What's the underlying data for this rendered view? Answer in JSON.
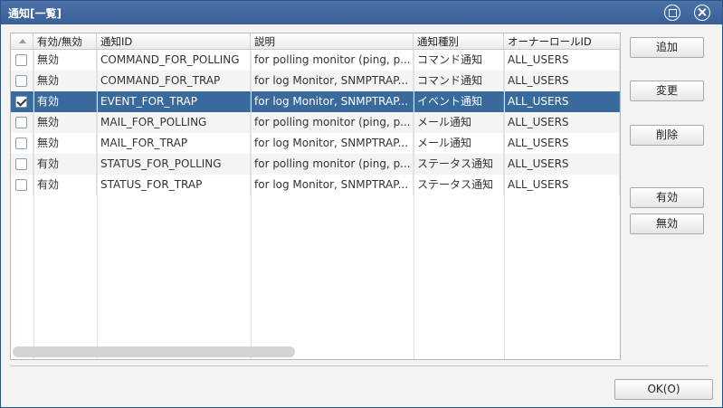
{
  "window": {
    "title": "通知[一覧]"
  },
  "grid": {
    "columns": [
      "有効/無効",
      "通知ID",
      "説明",
      "通知種別",
      "オーナーロールID"
    ],
    "rows": [
      {
        "checked": false,
        "enabled": "無効",
        "id": "COMMAND_FOR_POLLING",
        "desc": "for polling monitor (ping, p...",
        "type": "コマンド通知",
        "owner": "ALL_USERS"
      },
      {
        "checked": false,
        "enabled": "無効",
        "id": "COMMAND_FOR_TRAP",
        "desc": "for log Monitor, SNMPTRAP...",
        "type": "コマンド通知",
        "owner": "ALL_USERS"
      },
      {
        "checked": true,
        "enabled": "有効",
        "id": "EVENT_FOR_TRAP",
        "desc": "for log Monitor, SNMPTRAP...",
        "type": "イベント通知",
        "owner": "ALL_USERS"
      },
      {
        "checked": false,
        "enabled": "無効",
        "id": "MAIL_FOR_POLLING",
        "desc": "for polling monitor (ping, p...",
        "type": "メール通知",
        "owner": "ALL_USERS"
      },
      {
        "checked": false,
        "enabled": "無効",
        "id": "MAIL_FOR_TRAP",
        "desc": "for log Monitor, SNMPTRAP...",
        "type": "メール通知",
        "owner": "ALL_USERS"
      },
      {
        "checked": false,
        "enabled": "有効",
        "id": "STATUS_FOR_POLLING",
        "desc": "for polling monitor (ping, p...",
        "type": "ステータス通知",
        "owner": "ALL_USERS"
      },
      {
        "checked": false,
        "enabled": "有効",
        "id": "STATUS_FOR_TRAP",
        "desc": "for log Monitor, SNMPTRAP...",
        "type": "ステータス通知",
        "owner": "ALL_USERS"
      }
    ],
    "selected_index": 2
  },
  "buttons": {
    "add": "追加",
    "modify": "変更",
    "delete": "削除",
    "enable": "有効",
    "disable": "無効",
    "ok": "OK(O)"
  },
  "icons": {
    "maximize": "maximize-icon",
    "close": "close-icon",
    "sort": "sort-ascending-icon",
    "check": "check-icon"
  }
}
